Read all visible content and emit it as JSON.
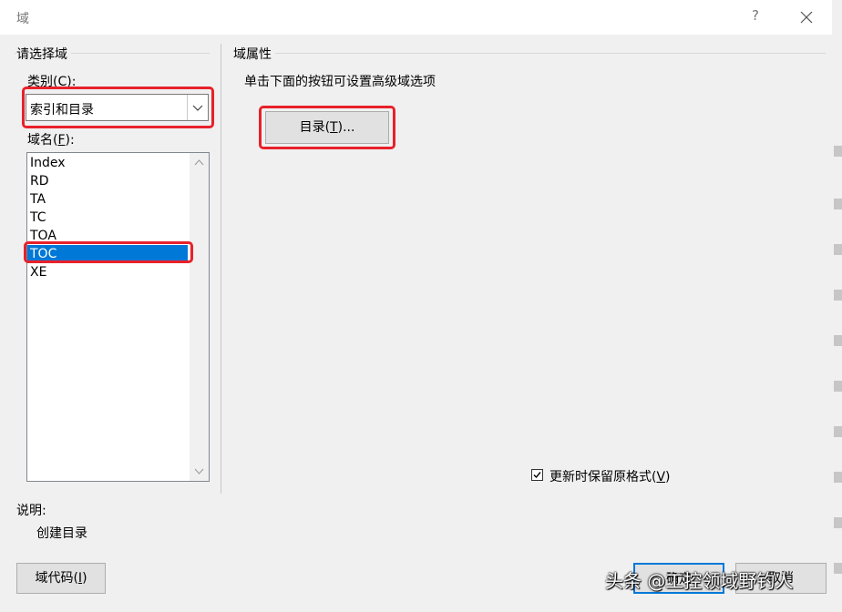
{
  "window": {
    "title": "域",
    "help_label": "?"
  },
  "left": {
    "group_title": "请选择域",
    "category_label": "类别(C):",
    "category_value": "索引和目录",
    "fieldname_label": "域名(F):",
    "fields": [
      "Index",
      "RD",
      "TA",
      "TC",
      "TOA",
      "TOC",
      "XE"
    ],
    "selected_index": 5
  },
  "right": {
    "group_title": "域属性",
    "hint": "单击下面的按钮可设置高级域选项",
    "toc_button": "目录(T)...",
    "preserve_format_label": "更新时保留原格式(V)",
    "preserve_format_checked": true
  },
  "description": {
    "label": "说明:",
    "text": "创建目录"
  },
  "footer": {
    "field_codes_button": "域代码(I)",
    "ok_button": "确定",
    "cancel_button": "取消"
  },
  "watermark": "头条 @工控领域野钓人",
  "colors": {
    "selection": "#0078d7",
    "highlight_box": "#e8212a",
    "dialog_bg": "#f0f0f0"
  }
}
